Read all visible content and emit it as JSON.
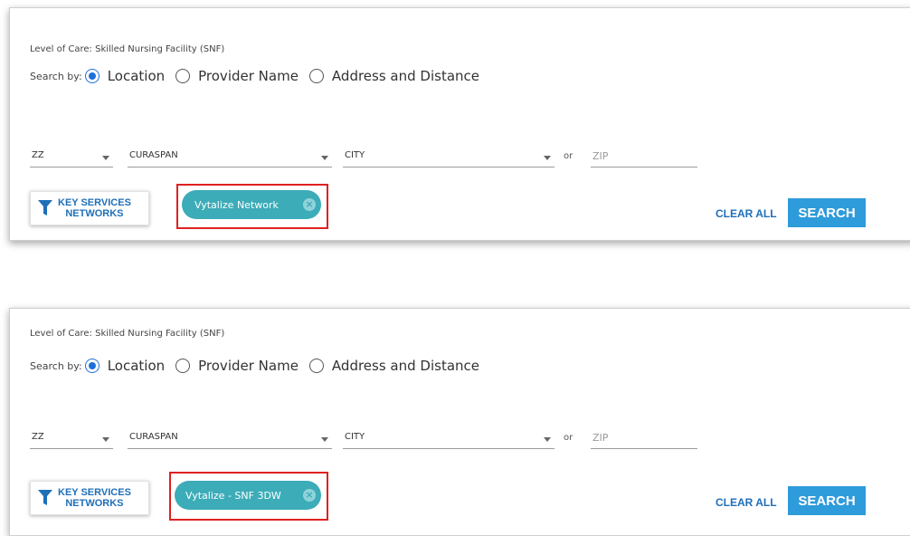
{
  "panels": [
    {
      "level_of_care": "Level of Care: Skilled Nursing Facility (SNF)",
      "search_by_label": "Search by:",
      "radio_options": [
        "Location",
        "Provider Name",
        "Address and Distance"
      ],
      "selected_option": "Location",
      "state_value": "ZZ",
      "county_value": "CURASPAN",
      "city_value": "CITY",
      "or_text": "or",
      "zip_placeholder": "ZIP",
      "key_services_line1": "KEY SERVICES",
      "key_services_line2": "NETWORKS",
      "chip_label": "Vytalize Network",
      "clear_all_label": "CLEAR ALL",
      "search_label": "SEARCH"
    },
    {
      "level_of_care": "Level of Care: Skilled Nursing Facility (SNF)",
      "search_by_label": "Search by:",
      "radio_options": [
        "Location",
        "Provider Name",
        "Address and Distance"
      ],
      "selected_option": "Location",
      "state_value": "ZZ",
      "county_value": "CURASPAN",
      "city_value": "CITY",
      "or_text": "or",
      "zip_placeholder": "ZIP",
      "key_services_line1": "KEY SERVICES",
      "key_services_line2": "NETWORKS",
      "chip_label": "Vytalize - SNF 3DW",
      "clear_all_label": "CLEAR ALL",
      "search_label": "SEARCH"
    }
  ],
  "colors": {
    "accent_blue": "#1e6fb8",
    "search_button": "#2e9bdb",
    "chip_teal": "#3cacb8",
    "highlight_red": "#e02020",
    "radio_selected": "#1e6fd9"
  }
}
